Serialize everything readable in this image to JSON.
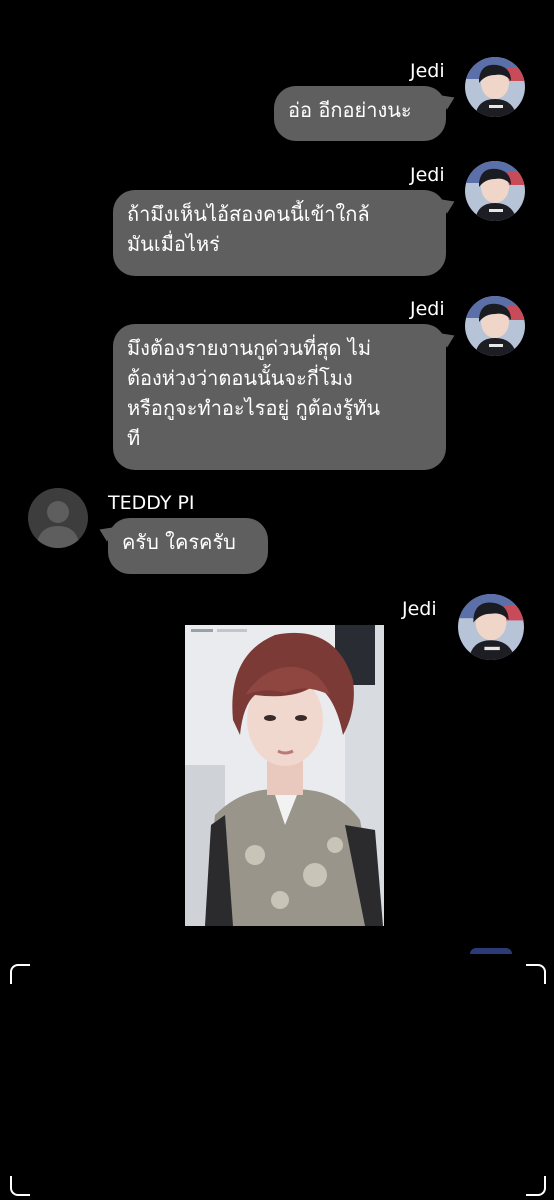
{
  "messages": [
    {
      "sender": "Jedi",
      "side": "right",
      "lines": [
        "อ่อ อีกอย่างนะ"
      ]
    },
    {
      "sender": "Jedi",
      "side": "right",
      "lines": [
        "ถ้ามึงเห็นไอ้สองคนนี้เข้าใกล้",
        "มันเมื่อไหร่"
      ]
    },
    {
      "sender": "Jedi",
      "side": "right",
      "lines": [
        "มึงต้องรายงานกูด่วนที่สุด ไม่",
        "ต้องห่วงว่าตอนนั้นจะกี่โมง",
        "หรือกูจะทำอะไรอยู่ กูต้องรู้ทัน",
        "ที"
      ]
    },
    {
      "sender": "TEDDY PI",
      "side": "left",
      "lines": [
        "ครับ ใครครับ"
      ]
    },
    {
      "sender": "Jedi",
      "side": "right",
      "type": "image"
    }
  ],
  "colors": {
    "background": "#000000",
    "bubble": "#5f5f5f",
    "text": "#ffffff"
  },
  "icons": {
    "jedi_avatar": "person-photo-avatar",
    "teddy_avatar": "default-user-silhouette-icon"
  }
}
